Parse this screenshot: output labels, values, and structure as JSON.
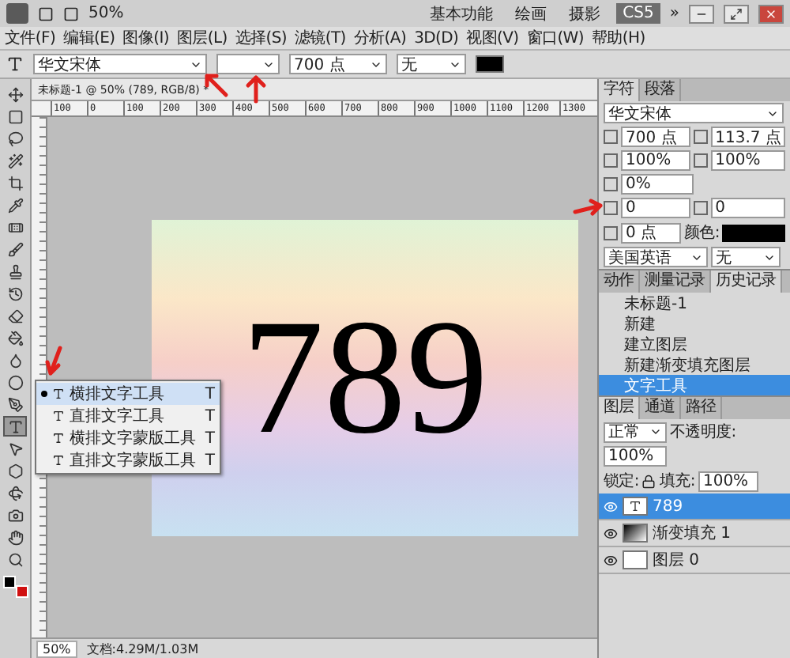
{
  "app_bar": {
    "zoom": "50%",
    "workspaces": [
      {
        "label": "基本功能",
        "selected": false
      },
      {
        "label": "绘画",
        "selected": false
      },
      {
        "label": "摄影",
        "selected": false
      },
      {
        "label": "CS5",
        "selected": true
      }
    ],
    "more": "»"
  },
  "menu": [
    "文件(F)",
    "编辑(E)",
    "图像(I)",
    "图层(L)",
    "选择(S)",
    "滤镜(T)",
    "分析(A)",
    "3D(D)",
    "视图(V)",
    "窗口(W)",
    "帮助(H)"
  ],
  "options": {
    "font_family": "华文宋体",
    "font_size": "700 点",
    "anti_alias": "无"
  },
  "tools": [
    {
      "kind": "move",
      "selected": false
    },
    {
      "kind": "marquee",
      "selected": false
    },
    {
      "kind": "lasso",
      "selected": false
    },
    {
      "kind": "wand",
      "selected": false
    },
    {
      "kind": "crop",
      "selected": false
    },
    {
      "kind": "eyedropper",
      "selected": false
    },
    {
      "kind": "heal",
      "selected": false
    },
    {
      "kind": "brush",
      "selected": false
    },
    {
      "kind": "stamp",
      "selected": false
    },
    {
      "kind": "history",
      "selected": false
    },
    {
      "kind": "eraser",
      "selected": false
    },
    {
      "kind": "gradient",
      "selected": false
    },
    {
      "kind": "blur",
      "selected": false
    },
    {
      "kind": "dodge",
      "selected": false
    },
    {
      "kind": "pen",
      "selected": false
    },
    {
      "kind": "text",
      "selected": true
    },
    {
      "kind": "select",
      "selected": false
    },
    {
      "kind": "shape",
      "selected": false
    },
    {
      "kind": "rotate3d",
      "selected": false
    },
    {
      "kind": "camera3d",
      "selected": false
    },
    {
      "kind": "hand",
      "selected": false
    },
    {
      "kind": "zoom",
      "selected": false
    }
  ],
  "tools_flyout": [
    {
      "label": "横排文字工具",
      "shortcut": "T",
      "selected": true
    },
    {
      "label": "直排文字工具",
      "shortcut": "T",
      "selected": false
    },
    {
      "label": "横排文字蒙版工具",
      "shortcut": "T",
      "selected": false
    },
    {
      "label": "直排文字蒙版工具",
      "shortcut": "T",
      "selected": false
    }
  ],
  "document": {
    "tab": "未标题-1 @ 50% (789, RGB/8) *",
    "ruler": [
      "100",
      "0",
      "100",
      "200",
      "300",
      "400",
      "500",
      "600",
      "700",
      "800",
      "900",
      "1000",
      "1100",
      "1200",
      "1300"
    ],
    "text": "789",
    "zoom": "50%",
    "doc_info": "文档:4.29M/1.03M"
  },
  "character_panel": {
    "tabs": [
      {
        "label": "字符",
        "selected": true
      },
      {
        "label": "段落",
        "selected": false
      }
    ],
    "font": "华文宋体",
    "size": "700 点",
    "leading": "113.7 点",
    "vscale": "100%",
    "hscale": "100%",
    "tsume": "0%",
    "kerning": "0",
    "tracking": "0",
    "baseline": "0 点",
    "color_label": "颜色:",
    "language": "美国英语",
    "aa": "无"
  },
  "history_panel": {
    "tabs": [
      {
        "label": "动作",
        "selected": false
      },
      {
        "label": "测量记录",
        "selected": false
      },
      {
        "label": "历史记录",
        "selected": true
      }
    ],
    "snapshot": "未标题-1",
    "items": [
      {
        "label": "新建",
        "selected": false
      },
      {
        "label": "建立图层",
        "selected": false
      },
      {
        "label": "新建渐变填充图层",
        "selected": false
      },
      {
        "label": "文字工具",
        "selected": true
      }
    ]
  },
  "layers_panel": {
    "tabs": [
      {
        "label": "图层",
        "selected": true
      },
      {
        "label": "通道",
        "selected": false
      },
      {
        "label": "路径",
        "selected": false
      }
    ],
    "blend": "正常",
    "opacity_label": "不透明度:",
    "opacity": "100%",
    "lock_label": "锁定:",
    "fill_label": "填充:",
    "fill": "100%",
    "layers": [
      {
        "name": "789",
        "kind": "text",
        "selected": true
      },
      {
        "name": "渐变填充 1",
        "kind": "gradient",
        "selected": false
      },
      {
        "name": "图层 0",
        "kind": "plain",
        "selected": false
      }
    ]
  }
}
